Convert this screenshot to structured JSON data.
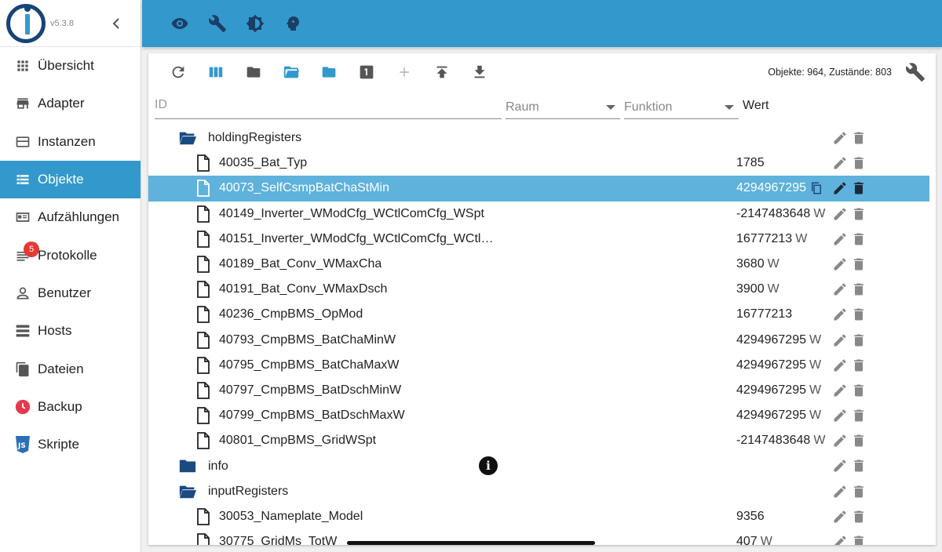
{
  "app": {
    "version": "v5.3.8"
  },
  "colors": {
    "accent": "#3399cc",
    "selected_row": "#5eb2dc",
    "folder": "#1a4a80",
    "badge": "#e53935"
  },
  "sidebar": {
    "items": [
      {
        "label": "Übersicht",
        "icon": "grid-icon"
      },
      {
        "label": "Adapter",
        "icon": "store-icon"
      },
      {
        "label": "Instanzen",
        "icon": "instances-icon"
      },
      {
        "label": "Objekte",
        "icon": "list-icon",
        "active": true
      },
      {
        "label": "Aufzählungen",
        "icon": "enum-icon"
      },
      {
        "label": "Protokolle",
        "icon": "log-icon",
        "badge": "5"
      },
      {
        "label": "Benutzer",
        "icon": "person-icon"
      },
      {
        "label": "Hosts",
        "icon": "server-icon"
      },
      {
        "label": "Dateien",
        "icon": "files-icon"
      },
      {
        "label": "Backup",
        "icon": "backup-icon"
      },
      {
        "label": "Skripte",
        "icon": "js-icon"
      }
    ]
  },
  "topbar": {
    "icons": [
      "eye-icon",
      "wrench-icon",
      "brightness-icon",
      "expert-head-icon"
    ]
  },
  "toolbar": {
    "stats": "Objekte: 964, Zustände: 803",
    "buttons": [
      "refresh-icon",
      "columns-icon",
      "folder-closed-icon",
      "folder-open-icon",
      "folder-blue-icon",
      "number-one-icon",
      "add-icon",
      "upload-icon",
      "download-icon"
    ]
  },
  "filters": {
    "id_placeholder": "ID",
    "raum_placeholder": "Raum",
    "funktion_placeholder": "Funktion",
    "wert_header": "Wert"
  },
  "tree": {
    "rows": [
      {
        "type": "folder-open",
        "level": 1,
        "name": "holdingRegisters",
        "value": "",
        "unit": ""
      },
      {
        "type": "state",
        "level": 2,
        "name": "40035_Bat_Typ",
        "value": "1785",
        "unit": ""
      },
      {
        "type": "state",
        "level": 2,
        "name": "40073_SelfCsmpBatChaStMin",
        "value": "4294967295",
        "unit": "",
        "selected": true
      },
      {
        "type": "state",
        "level": 2,
        "name": "40149_Inverter_WModCfg_WCtlComCfg_WSpt",
        "value": "-2147483648",
        "unit": "W"
      },
      {
        "type": "state",
        "level": 2,
        "name": "40151_Inverter_WModCfg_WCtlComCfg_WCtl…",
        "value": "16777213",
        "unit": "W"
      },
      {
        "type": "state",
        "level": 2,
        "name": "40189_Bat_Conv_WMaxCha",
        "value": "3680",
        "unit": "W"
      },
      {
        "type": "state",
        "level": 2,
        "name": "40191_Bat_Conv_WMaxDsch",
        "value": "3900",
        "unit": "W"
      },
      {
        "type": "state",
        "level": 2,
        "name": "40236_CmpBMS_OpMod",
        "value": "16777213",
        "unit": ""
      },
      {
        "type": "state",
        "level": 2,
        "name": "40793_CmpBMS_BatChaMinW",
        "value": "4294967295",
        "unit": "W"
      },
      {
        "type": "state",
        "level": 2,
        "name": "40795_CmpBMS_BatChaMaxW",
        "value": "4294967295",
        "unit": "W"
      },
      {
        "type": "state",
        "level": 2,
        "name": "40797_CmpBMS_BatDschMinW",
        "value": "4294967295",
        "unit": "W"
      },
      {
        "type": "state",
        "level": 2,
        "name": "40799_CmpBMS_BatDschMaxW",
        "value": "4294967295",
        "unit": "W"
      },
      {
        "type": "state",
        "level": 2,
        "name": "40801_CmpBMS_GridWSpt",
        "value": "-2147483648",
        "unit": "W"
      },
      {
        "type": "folder-closed",
        "level": 1,
        "name": "info",
        "value": "",
        "unit": "",
        "info": "i"
      },
      {
        "type": "folder-open",
        "level": 1,
        "name": "inputRegisters",
        "value": "",
        "unit": ""
      },
      {
        "type": "state",
        "level": 2,
        "name": "30053_Nameplate_Model",
        "value": "9356",
        "unit": ""
      },
      {
        "type": "state",
        "level": 2,
        "name": "30775_GridMs_TotW",
        "value": "407",
        "unit": "W"
      }
    ]
  }
}
